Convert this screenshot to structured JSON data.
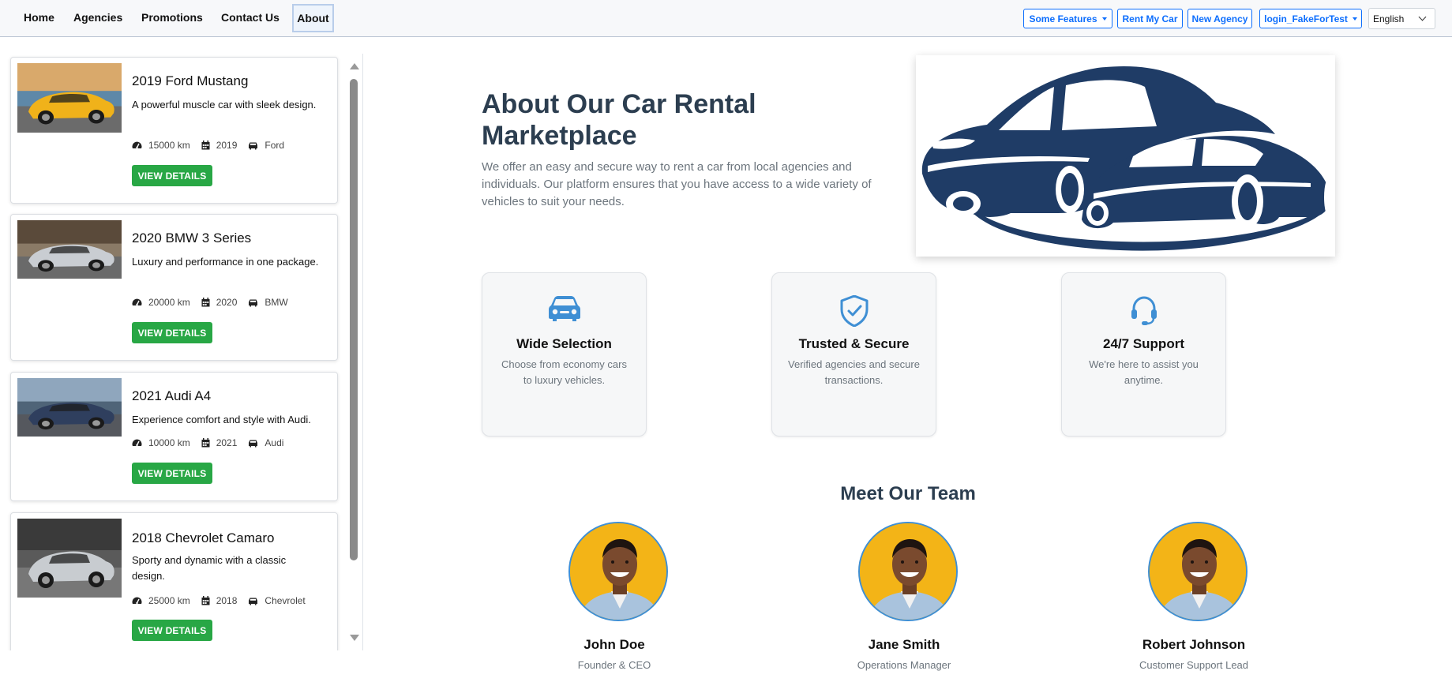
{
  "nav": {
    "links": [
      "Home",
      "Agencies",
      "Promotions",
      "Contact Us"
    ],
    "active": "About",
    "buttons": {
      "features": "Some Features",
      "rent": "Rent My Car",
      "agency": "New Agency",
      "login": "login_FakeForTest"
    },
    "language": "English"
  },
  "colors": {
    "accent": "#0d6efd",
    "success": "#28a745",
    "heading": "#2c3e50",
    "muted": "#6c757d",
    "icon": "#3f8fd4"
  },
  "cars": [
    {
      "title": "2019 Ford Mustang",
      "desc": "A powerful muscle car with sleek design.",
      "km": "15000 km",
      "year": "2019",
      "brand": "Ford",
      "button": "VIEW DETAILS",
      "color": "#f0b21a",
      "scene": "sunset"
    },
    {
      "title": "2020 BMW 3 Series",
      "desc": "Luxury and performance in one package.",
      "km": "20000 km",
      "year": "2020",
      "brand": "BMW",
      "button": "VIEW DETAILS",
      "color": "#c9cdd2",
      "scene": "forest"
    },
    {
      "title": "2021 Audi A4",
      "desc": "Experience comfort and style with Audi.",
      "km": "10000 km",
      "year": "2021",
      "brand": "Audi",
      "button": "VIEW DETAILS",
      "color": "#2f3f5e",
      "scene": "mountain"
    },
    {
      "title": "2018 Chevrolet Camaro",
      "desc": "Sporty and dynamic with a classic design.",
      "km": "25000 km",
      "year": "2018",
      "brand": "Chevrolet",
      "button": "VIEW DETAILS",
      "color": "#c8ccd0",
      "scene": "dark"
    }
  ],
  "about": {
    "title": "About Our Car Rental Marketplace",
    "text": "We offer an easy and secure way to rent a car from local agencies and individuals. Our platform ensures that you have access to a wide variety of vehicles to suit your needs."
  },
  "features": [
    {
      "icon": "car-icon",
      "title": "Wide Selection",
      "desc": "Choose from economy cars to luxury vehicles."
    },
    {
      "icon": "shield-check-icon",
      "title": "Trusted & Secure",
      "desc": "Verified agencies and secure transactions."
    },
    {
      "icon": "headset-icon",
      "title": "24/7 Support",
      "desc": "We're here to assist you anytime."
    }
  ],
  "team": {
    "heading": "Meet Our Team",
    "members": [
      {
        "name": "John Doe",
        "role": "Founder & CEO"
      },
      {
        "name": "Jane Smith",
        "role": "Operations Manager"
      },
      {
        "name": "Robert Johnson",
        "role": "Customer Support Lead"
      }
    ]
  }
}
